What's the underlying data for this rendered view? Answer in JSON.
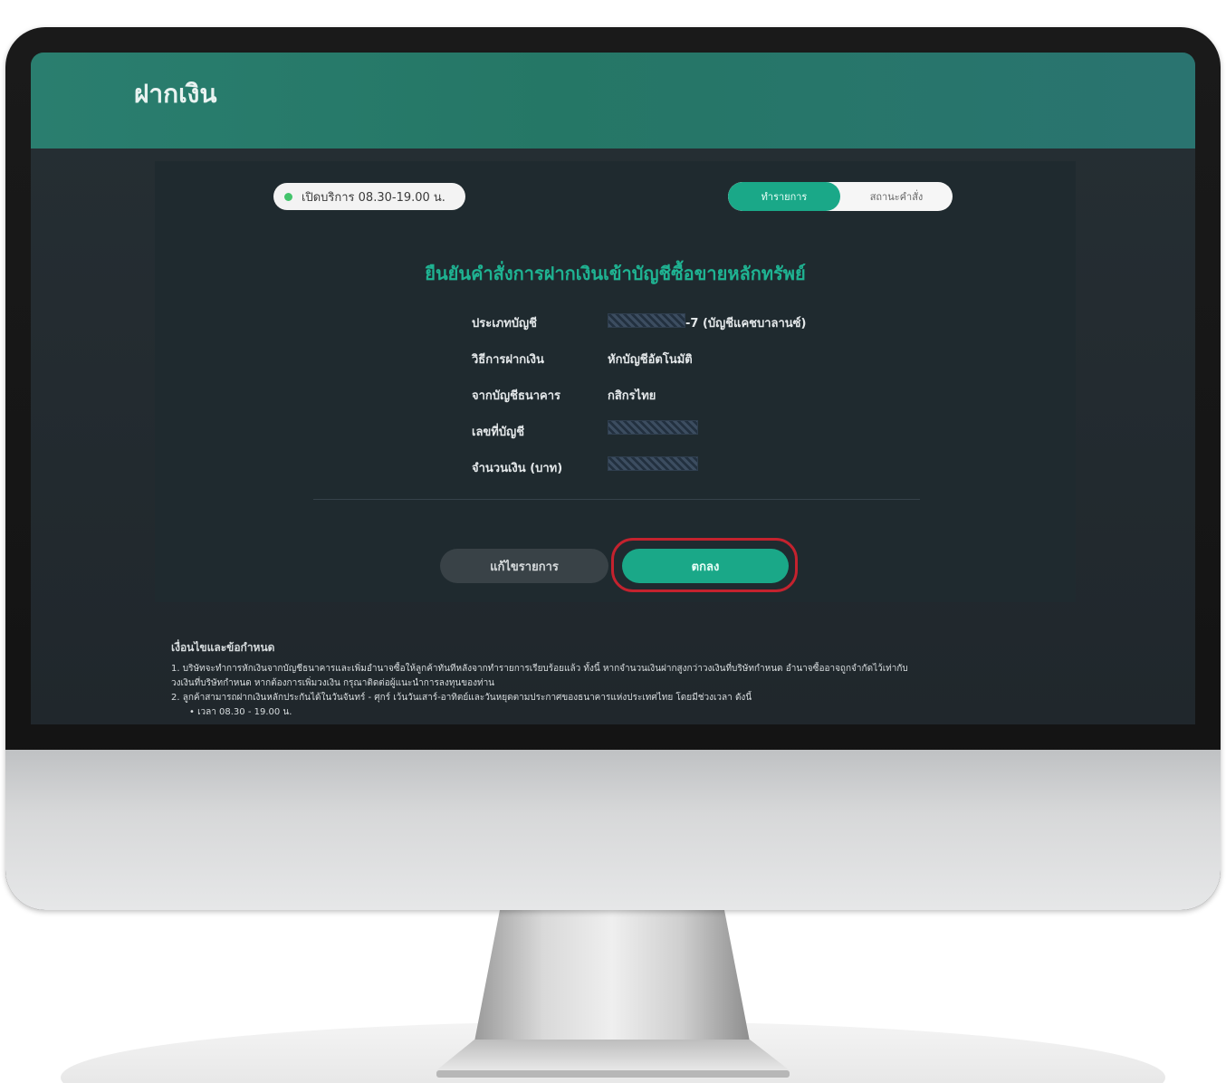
{
  "header": {
    "title": "ฝากเงิน"
  },
  "status": {
    "hours": "เปิดบริการ 08.30-19.00 น."
  },
  "tabs": [
    {
      "label": "ทำรายการ",
      "active": true
    },
    {
      "label": "สถานะคำสั่ง",
      "active": false
    }
  ],
  "confirm": {
    "title": "ยืนยันคำสั่งการฝากเงินเข้าบัญชีซื้อขายหลักทรัพย์",
    "rows": [
      {
        "label": "ประเภทบัญชี",
        "value": "-7 (บัญชีแคชบาลานซ์)"
      },
      {
        "label": "วิธีการฝากเงิน",
        "value": "หักบัญชีอัตโนมัติ"
      },
      {
        "label": "จากบัญชีธนาคาร",
        "value": "กสิกรไทย"
      },
      {
        "label": "เลขที่บัญชี",
        "value": ""
      },
      {
        "label": "จำนวนเงิน (บาท)",
        "value": ""
      }
    ]
  },
  "buttons": {
    "edit": "แก้ไขรายการ",
    "ok": "ตกลง"
  },
  "terms": {
    "title": "เงื่อนไขและข้อกำหนด",
    "lines": [
      "1. บริษัทจะทำการหักเงินจากบัญชีธนาคารและเพิ่มอำนาจซื้อให้ลูกค้าทันทีหลังจากทำรายการเรียบร้อยแล้ว ทั้งนี้ หากจำนวนเงินฝากสูงกว่าวงเงินที่บริษัทกำหนด อำนาจซื้ออาจถูกจำกัดไว้เท่ากับ",
      "วงเงินที่บริษัทกำหนด หากต้องการเพิ่มวงเงิน กรุณาติดต่อผู้แนะนำการลงทุนของท่าน",
      "2. ลูกค้าสามารถฝากเงินหลักประกันได้ในวันจันทร์ - ศุกร์ เว้นวันเสาร์-อาทิตย์และวันหยุดตามประกาศของธนาคารแห่งประเทศไทย โดยมีช่วงเวลา ดังนี้",
      "• เวลา 08.30 - 19.00 น."
    ]
  },
  "colors": {
    "accent": "#1aa888",
    "header": "#257766",
    "highlight": "#c4222e"
  }
}
